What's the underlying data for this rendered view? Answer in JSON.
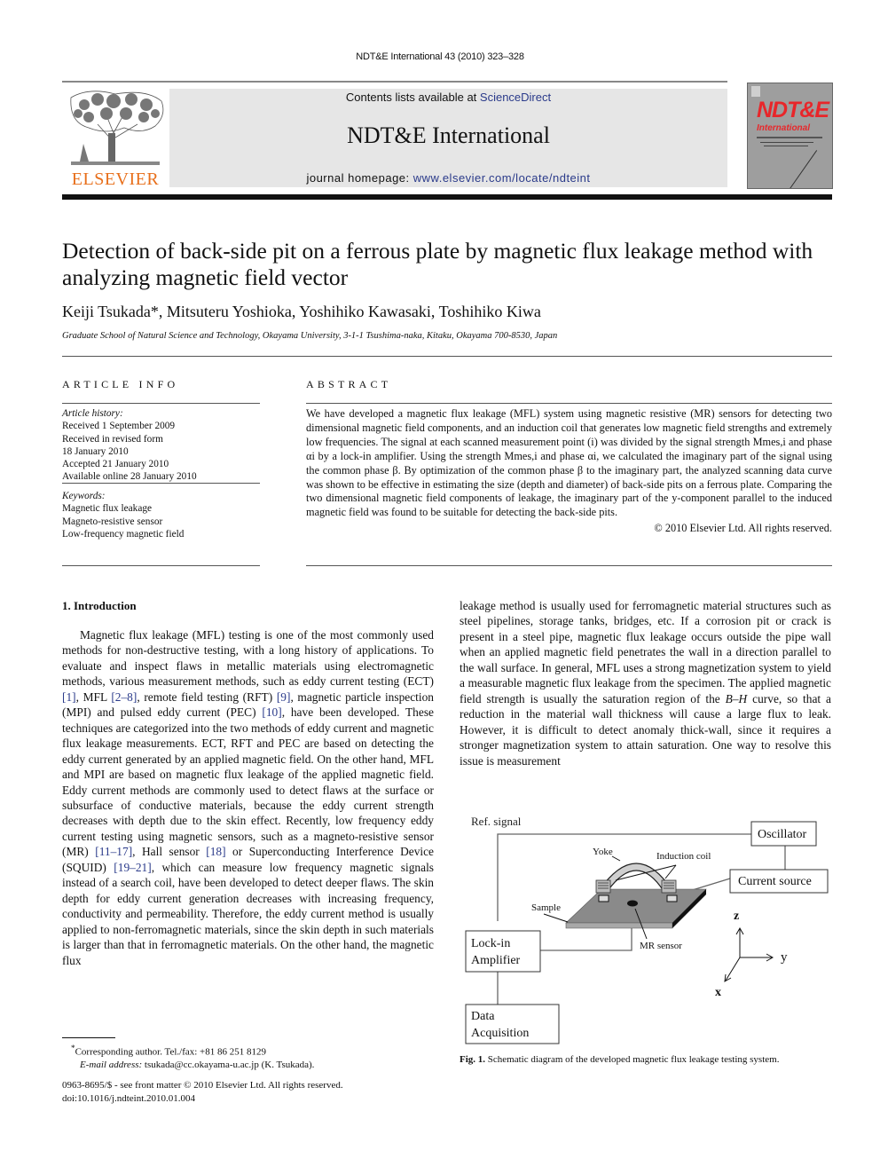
{
  "running_header": "NDT&E International 43 (2010) 323–328",
  "publisher": {
    "logo_text": "ELSEVIER",
    "contents_prefix": "Contents lists available at ",
    "contents_link": "ScienceDirect",
    "journal_title": "NDT&E International",
    "homepage_prefix": "journal homepage: ",
    "homepage_link": "www.elsevier.com/locate/ndteint",
    "cover_title": "NDT&E",
    "cover_subtitle": "International",
    "accent_color": "#e86f1b",
    "link_color": "#2a3a8a"
  },
  "article": {
    "title": "Detection of back-side pit on a ferrous plate by magnetic flux leakage method with analyzing magnetic field vector",
    "authors": "Keiji Tsukada*, Mitsuteru Yoshioka, Yoshihiko Kawasaki, Toshihiko Kiwa",
    "affiliation": "Graduate School of Natural Science and Technology, Okayama University, 3-1-1 Tsushima-naka, Kitaku, Okayama 700-8530, Japan"
  },
  "article_info": {
    "heading": "ARTICLE INFO",
    "history_label": "Article history:",
    "history": [
      "Received 1 September 2009",
      "Received in revised form",
      "18 January 2010",
      "Accepted 21 January 2010",
      "Available online 28 January 2010"
    ],
    "keywords_label": "Keywords:",
    "keywords": [
      "Magnetic flux leakage",
      "Magneto-resistive sensor",
      "Low-frequency magnetic field"
    ]
  },
  "abstract": {
    "heading": "ABSTRACT",
    "text": "We have developed a magnetic flux leakage (MFL) system using magnetic resistive (MR) sensors for detecting two dimensional magnetic field components, and an induction coil that generates low magnetic field strengths and extremely low frequencies. The signal at each scanned measurement point (i) was divided by the signal strength Mmes,i and phase αi by a lock-in amplifier. Using the strength Mmes,i and phase αi, we calculated the imaginary part of the signal using the common phase β. By optimization of the common phase β to the imaginary part, the analyzed scanning data curve was shown to be effective in estimating the size (depth and diameter) of back-side pits on a ferrous plate. Comparing the two dimensional magnetic field components of leakage, the imaginary part of the y-component parallel to the induced magnetic field was found to be suitable for detecting the back-side pits.",
    "copyright": "© 2010 Elsevier Ltd. All rights reserved."
  },
  "section1": {
    "heading": "1.  Introduction",
    "left_segments": [
      "Magnetic flux leakage (MFL) testing is one of the most commonly used methods for non-destructive testing, with a long history of applications. To evaluate and inspect flaws in metallic materials using electromagnetic methods, various measurement methods, such as eddy current testing (ECT) ",
      "[1]",
      ", MFL ",
      "[2–8]",
      ", remote field testing (RFT) ",
      "[9]",
      ", magnetic particle inspection (MPI) and pulsed eddy current (PEC) ",
      "[10]",
      ", have been developed. These techniques are categorized into the two methods of eddy current and magnetic flux leakage measurements. ECT, RFT and PEC are based on detecting the eddy current generated by an applied magnetic field. On the other hand, MFL and MPI are based on magnetic flux leakage of the applied magnetic field. Eddy current methods are commonly used to detect flaws at the surface or subsurface of conductive materials, because the eddy current strength decreases with depth due to the skin effect. Recently, low frequency eddy current testing using magnetic sensors, such as a magneto-resistive sensor (MR) ",
      "[11–17]",
      ", Hall sensor ",
      "[18]",
      " or Superconducting Interference Device (SQUID) ",
      "[19–21]",
      ", which can measure low frequency magnetic signals instead of a search coil, have been developed to detect deeper flaws. The skin depth for eddy current generation decreases with increasing frequency, conductivity and permeability. Therefore, the eddy current method is usually applied to non-ferromagnetic materials, since the skin depth in such materials is larger than that in ferromagnetic materials. On the other hand, the magnetic flux"
    ],
    "right_text_1": "leakage method is usually used for ferromagnetic material structures such as steel pipelines, storage tanks, bridges, etc. If a corrosion pit or crack is present in a steel pipe, magnetic flux leakage occurs outside the pipe wall when an applied magnetic field penetrates the wall in a direction parallel to the wall surface. In general, MFL uses a strong magnetization system to yield a measurable magnetic flux leakage from the specimen. The applied magnetic field strength is usually the saturation region of the ",
    "right_italic": "B–H",
    "right_text_2": " curve, so that a reduction in the material wall thickness will cause a large flux to leak. However, it is difficult to detect anomaly thick-wall, since it requires a stronger magnetization system to attain saturation. One way to resolve this issue is measurement"
  },
  "figure1": {
    "labels": {
      "ref_signal": "Ref. signal",
      "oscillator": "Oscillator",
      "yoke": "Yoke",
      "induction_coil": "Induction coil",
      "current_source": "Current source",
      "sample": "Sample",
      "lock_in_1": "Lock-in",
      "lock_in_2": "Amplifier",
      "mr_sensor": "MR sensor",
      "data_acq_1": "Data",
      "data_acq_2": "Acquisition",
      "axis_z": "z",
      "axis_y": "y",
      "axis_x": "x"
    },
    "caption_label": "Fig. 1.",
    "caption_text": " Schematic diagram of the developed magnetic flux leakage testing system."
  },
  "footnote": {
    "line1": "Corresponding author. Tel./fax: +81 86 251 8129",
    "email_label": "E-mail address:",
    "email_value": " tsukada@cc.okayama-u.ac.jp (K. Tsukada).",
    "star": "*"
  },
  "issn": {
    "line1": "0963-8695/$ - see front matter © 2010 Elsevier Ltd. All rights reserved.",
    "line2": "doi:10.1016/j.ndteint.2010.01.004"
  }
}
